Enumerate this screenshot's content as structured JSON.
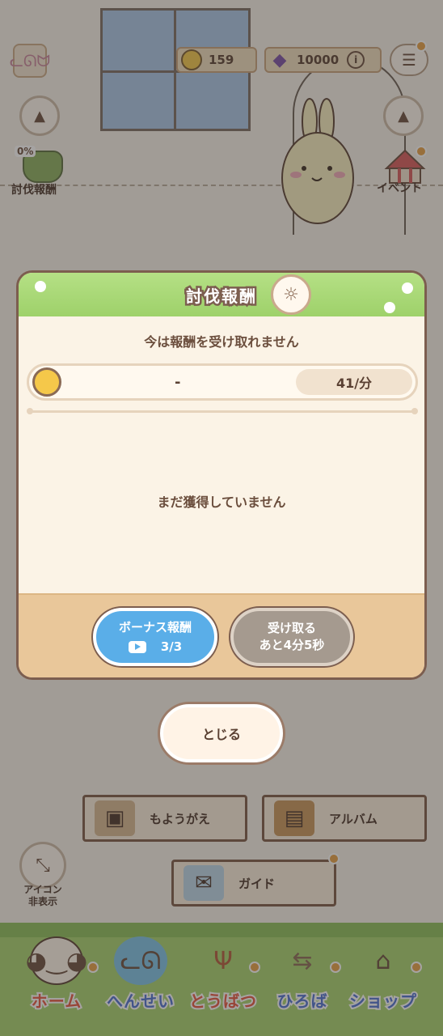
{
  "hud": {
    "coins": "159",
    "gems": "10000",
    "info_glyph": "i",
    "menu_icon": "list-icon",
    "profile_icon": "cat-face-icon"
  },
  "side": {
    "left_percent": "0%",
    "left_label": "討伐報酬",
    "right_label": "イベント"
  },
  "modal": {
    "title": "討伐報酬",
    "subtitle": "今は報酬を受け取れません",
    "reward_value": "-",
    "rate": "41/分",
    "empty_message": "まだ獲得していません",
    "bonus_label": "ボーナス報酬",
    "bonus_count": "3/3",
    "receive_line1": "受け取る",
    "receive_line2": "あと4分5秒"
  },
  "close_label": "とじる",
  "room_buttons": {
    "outfit": "もようがえ",
    "album": "アルバム",
    "guide": "ガイド"
  },
  "hide_icons_label": [
    "アイコン",
    "非表示"
  ],
  "nav": [
    {
      "label": "ホーム",
      "color": "#e8553f"
    },
    {
      "label": "へんせい",
      "color": "#4c6fd2"
    },
    {
      "label": "とうばつ",
      "color": "#e8553f"
    },
    {
      "label": "ひろば",
      "color": "#4c6fd2"
    },
    {
      "label": "ショップ",
      "color": "#4c6fd2"
    }
  ],
  "colors": {
    "accent_green": "#9ed16a",
    "bonus_blue": "#5aaee8",
    "disabled_gray": "#a59a8f",
    "notif_orange": "#e8a044"
  }
}
